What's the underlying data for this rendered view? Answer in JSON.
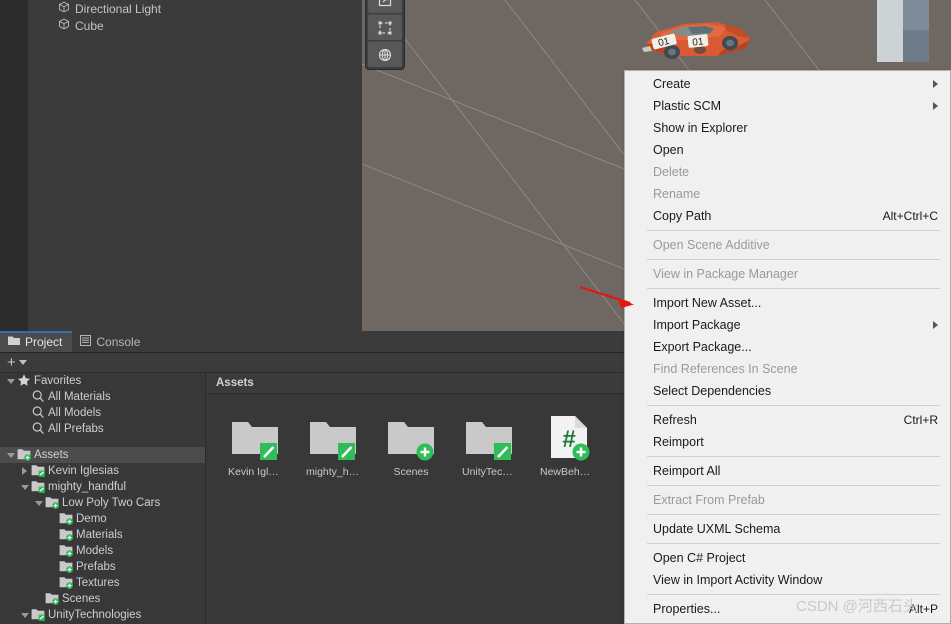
{
  "hierarchy": {
    "items": [
      {
        "label": "Directional Light",
        "icon": "cube-icon"
      },
      {
        "label": "Cube",
        "icon": "cube-icon"
      }
    ]
  },
  "scene": {
    "tools": [
      {
        "icon": "move-tool-icon"
      },
      {
        "icon": "rect-transform-tool-icon"
      },
      {
        "icon": "transform-tool-icon"
      }
    ],
    "model": "low-poly-race-car",
    "car_number": "01"
  },
  "project_window": {
    "tabs": [
      {
        "label": "Project",
        "icon": "folder-icon",
        "active": true
      },
      {
        "label": "Console",
        "icon": "console-icon",
        "active": false
      }
    ],
    "toolbar": {
      "add_label": "+",
      "dropdown_icon": "chevron-down-icon"
    },
    "tree": [
      {
        "label": "Favorites",
        "icon": "star-icon",
        "indent": 0,
        "twisty": "down",
        "selected": false
      },
      {
        "label": "All Materials",
        "icon": "search-icon",
        "indent": 1,
        "twisty": "none",
        "selected": false
      },
      {
        "label": "All Models",
        "icon": "search-icon",
        "indent": 1,
        "twisty": "none",
        "selected": false
      },
      {
        "label": "All Prefabs",
        "icon": "search-icon",
        "indent": 1,
        "twisty": "none",
        "selected": false
      },
      {
        "label": "",
        "icon": "none",
        "indent": 0,
        "twisty": "none",
        "selected": false
      },
      {
        "label": "Assets",
        "icon": "folder-plus-icon",
        "indent": 0,
        "twisty": "down",
        "selected": true
      },
      {
        "label": "Kevin Iglesias",
        "icon": "folder-check-icon",
        "indent": 1,
        "twisty": "right",
        "selected": false
      },
      {
        "label": "mighty_handful",
        "icon": "folder-check-icon",
        "indent": 1,
        "twisty": "down",
        "selected": false
      },
      {
        "label": "Low Poly Two Cars",
        "icon": "folder-plus-icon",
        "indent": 2,
        "twisty": "down",
        "selected": false
      },
      {
        "label": "Demo",
        "icon": "folder-plus-icon",
        "indent": 3,
        "twisty": "none",
        "selected": false
      },
      {
        "label": "Materials",
        "icon": "folder-plus-icon",
        "indent": 3,
        "twisty": "none",
        "selected": false
      },
      {
        "label": "Models",
        "icon": "folder-plus-icon",
        "indent": 3,
        "twisty": "none",
        "selected": false
      },
      {
        "label": "Prefabs",
        "icon": "folder-plus-icon",
        "indent": 3,
        "twisty": "none",
        "selected": false
      },
      {
        "label": "Textures",
        "icon": "folder-plus-icon",
        "indent": 3,
        "twisty": "none",
        "selected": false
      },
      {
        "label": "Scenes",
        "icon": "folder-plus-icon",
        "indent": 2,
        "twisty": "none",
        "selected": false
      },
      {
        "label": "UnityTechnologies",
        "icon": "folder-check-icon",
        "indent": 1,
        "twisty": "down",
        "selected": false
      }
    ],
    "assets_header": "Assets",
    "assets": [
      {
        "label": "Kevin Igles...",
        "type": "folder",
        "badge": "check"
      },
      {
        "label": "mighty_ha...",
        "type": "folder",
        "badge": "check"
      },
      {
        "label": "Scenes",
        "type": "folder",
        "badge": "plus"
      },
      {
        "label": "UnityTech...",
        "type": "folder",
        "badge": "check"
      },
      {
        "label": "NewBehav...",
        "type": "csharp",
        "badge": "plus"
      }
    ]
  },
  "context_menu": {
    "groups": [
      [
        {
          "label": "Create",
          "shortcut": "",
          "submenu": true,
          "disabled": false
        },
        {
          "label": "Plastic SCM",
          "shortcut": "",
          "submenu": true,
          "disabled": false
        },
        {
          "label": "Show in Explorer",
          "shortcut": "",
          "submenu": false,
          "disabled": false
        },
        {
          "label": "Open",
          "shortcut": "",
          "submenu": false,
          "disabled": false
        },
        {
          "label": "Delete",
          "shortcut": "",
          "submenu": false,
          "disabled": true
        },
        {
          "label": "Rename",
          "shortcut": "",
          "submenu": false,
          "disabled": true
        },
        {
          "label": "Copy Path",
          "shortcut": "Alt+Ctrl+C",
          "submenu": false,
          "disabled": false
        }
      ],
      [
        {
          "label": "Open Scene Additive",
          "shortcut": "",
          "submenu": false,
          "disabled": true
        }
      ],
      [
        {
          "label": "View in Package Manager",
          "shortcut": "",
          "submenu": false,
          "disabled": true
        }
      ],
      [
        {
          "label": "Import New Asset...",
          "shortcut": "",
          "submenu": false,
          "disabled": false
        },
        {
          "label": "Import Package",
          "shortcut": "",
          "submenu": true,
          "disabled": false
        },
        {
          "label": "Export Package...",
          "shortcut": "",
          "submenu": false,
          "disabled": false
        },
        {
          "label": "Find References In Scene",
          "shortcut": "",
          "submenu": false,
          "disabled": true
        },
        {
          "label": "Select Dependencies",
          "shortcut": "",
          "submenu": false,
          "disabled": false
        }
      ],
      [
        {
          "label": "Refresh",
          "shortcut": "Ctrl+R",
          "submenu": false,
          "disabled": false
        },
        {
          "label": "Reimport",
          "shortcut": "",
          "submenu": false,
          "disabled": false
        }
      ],
      [
        {
          "label": "Reimport All",
          "shortcut": "",
          "submenu": false,
          "disabled": false
        }
      ],
      [
        {
          "label": "Extract From Prefab",
          "shortcut": "",
          "submenu": false,
          "disabled": true
        }
      ],
      [
        {
          "label": "Update UXML Schema",
          "shortcut": "",
          "submenu": false,
          "disabled": false
        }
      ],
      [
        {
          "label": "Open C# Project",
          "shortcut": "",
          "submenu": false,
          "disabled": false
        },
        {
          "label": "View in Import Activity Window",
          "shortcut": "",
          "submenu": false,
          "disabled": false
        }
      ],
      [
        {
          "label": "Properties...",
          "shortcut": "Alt+P",
          "submenu": false,
          "disabled": false
        }
      ]
    ]
  },
  "annotation": {
    "type": "red-arrow",
    "points_to": "Import New Asset..."
  },
  "watermark": {
    "text": "CSDN @河西石头"
  },
  "colors": {
    "accent_blue": "#2f6fb5",
    "badge_green": "#2ebd59",
    "menu_bg": "#f0f0f0",
    "panel_bg": "#383838",
    "scene_bg": "#6f6862",
    "annotation_red": "#e8150f",
    "car_body": "#d95b33"
  }
}
